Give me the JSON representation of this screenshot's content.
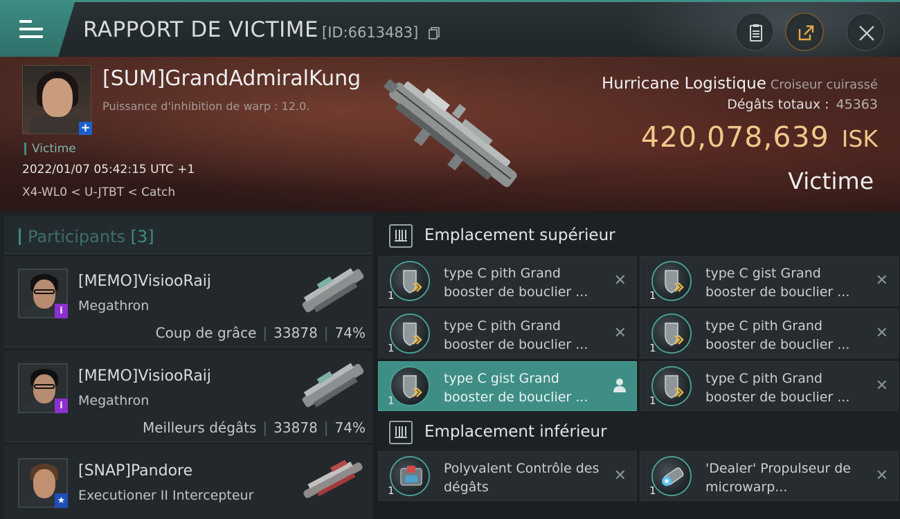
{
  "header": {
    "title": "RAPPORT DE VICTIME",
    "kill_id": "[ID:6613483]",
    "icons": [
      "menu-icon",
      "copy-icon",
      "report-icon",
      "share-icon",
      "close-icon"
    ]
  },
  "victim": {
    "name": "[SUM]GrandAdmiralKung",
    "subtitle": "Puissance d'inhibition de warp : 12.0.",
    "tag": "Victime",
    "datetime": "2022/01/07 05:42:15 UTC +1",
    "location": "X4-WL0 < U-JTBT < Catch",
    "ship_name": "Hurricane Logistique",
    "ship_class": "Croiseur cuirassé",
    "damage_label": "Dégâts totaux :",
    "damage_value": "45363",
    "isk_value": "420,078,639",
    "isk_unit": "ISK",
    "role_label": "Victime"
  },
  "participants": {
    "title": "Participants",
    "count": "[3]",
    "items": [
      {
        "name": "[MEMO]VisiooRaij",
        "ship": "Megathron",
        "role": "Coup de grâce",
        "damage": "33878",
        "percent": "74%",
        "badge": "i"
      },
      {
        "name": "[MEMO]VisiooRaij",
        "ship": "Megathron",
        "role": "Meilleurs dégâts",
        "damage": "33878",
        "percent": "74%",
        "badge": "i"
      },
      {
        "name": "[SNAP]Pandore",
        "ship": "Executioner II Intercepteur",
        "role": "",
        "damage": "",
        "percent": "",
        "badge": "★"
      }
    ]
  },
  "fitting": {
    "high_slot_title": "Emplacement supérieur",
    "low_slot_title": "Emplacement inférieur",
    "high_modules": [
      {
        "qty": "1",
        "name": "type C pith Grand booster de bouclier ...",
        "status": "destroyed"
      },
      {
        "qty": "1",
        "name": "type C gist Grand booster de bouclier ...",
        "status": "destroyed"
      },
      {
        "qty": "1",
        "name": "type C pith Grand booster de bouclier ...",
        "status": "destroyed"
      },
      {
        "qty": "1",
        "name": "type C pith Grand booster de bouclier ...",
        "status": "destroyed"
      },
      {
        "qty": "1",
        "name": "type C gist Grand booster de bouclier ...",
        "status": "dropped"
      },
      {
        "qty": "1",
        "name": "type C pith Grand booster de bouclier ...",
        "status": "destroyed"
      }
    ],
    "low_modules": [
      {
        "qty": "1",
        "name": "Polyvalent Contrôle des dégâts",
        "status": "destroyed"
      },
      {
        "qty": "1",
        "name": "'Dealer' Propulseur de microwarp...",
        "status": "destroyed"
      }
    ],
    "destroyed_mark": "✕"
  },
  "colors": {
    "accent": "#3c8c84",
    "isk": "#f2c78a",
    "active_row": "#3f8e86"
  }
}
